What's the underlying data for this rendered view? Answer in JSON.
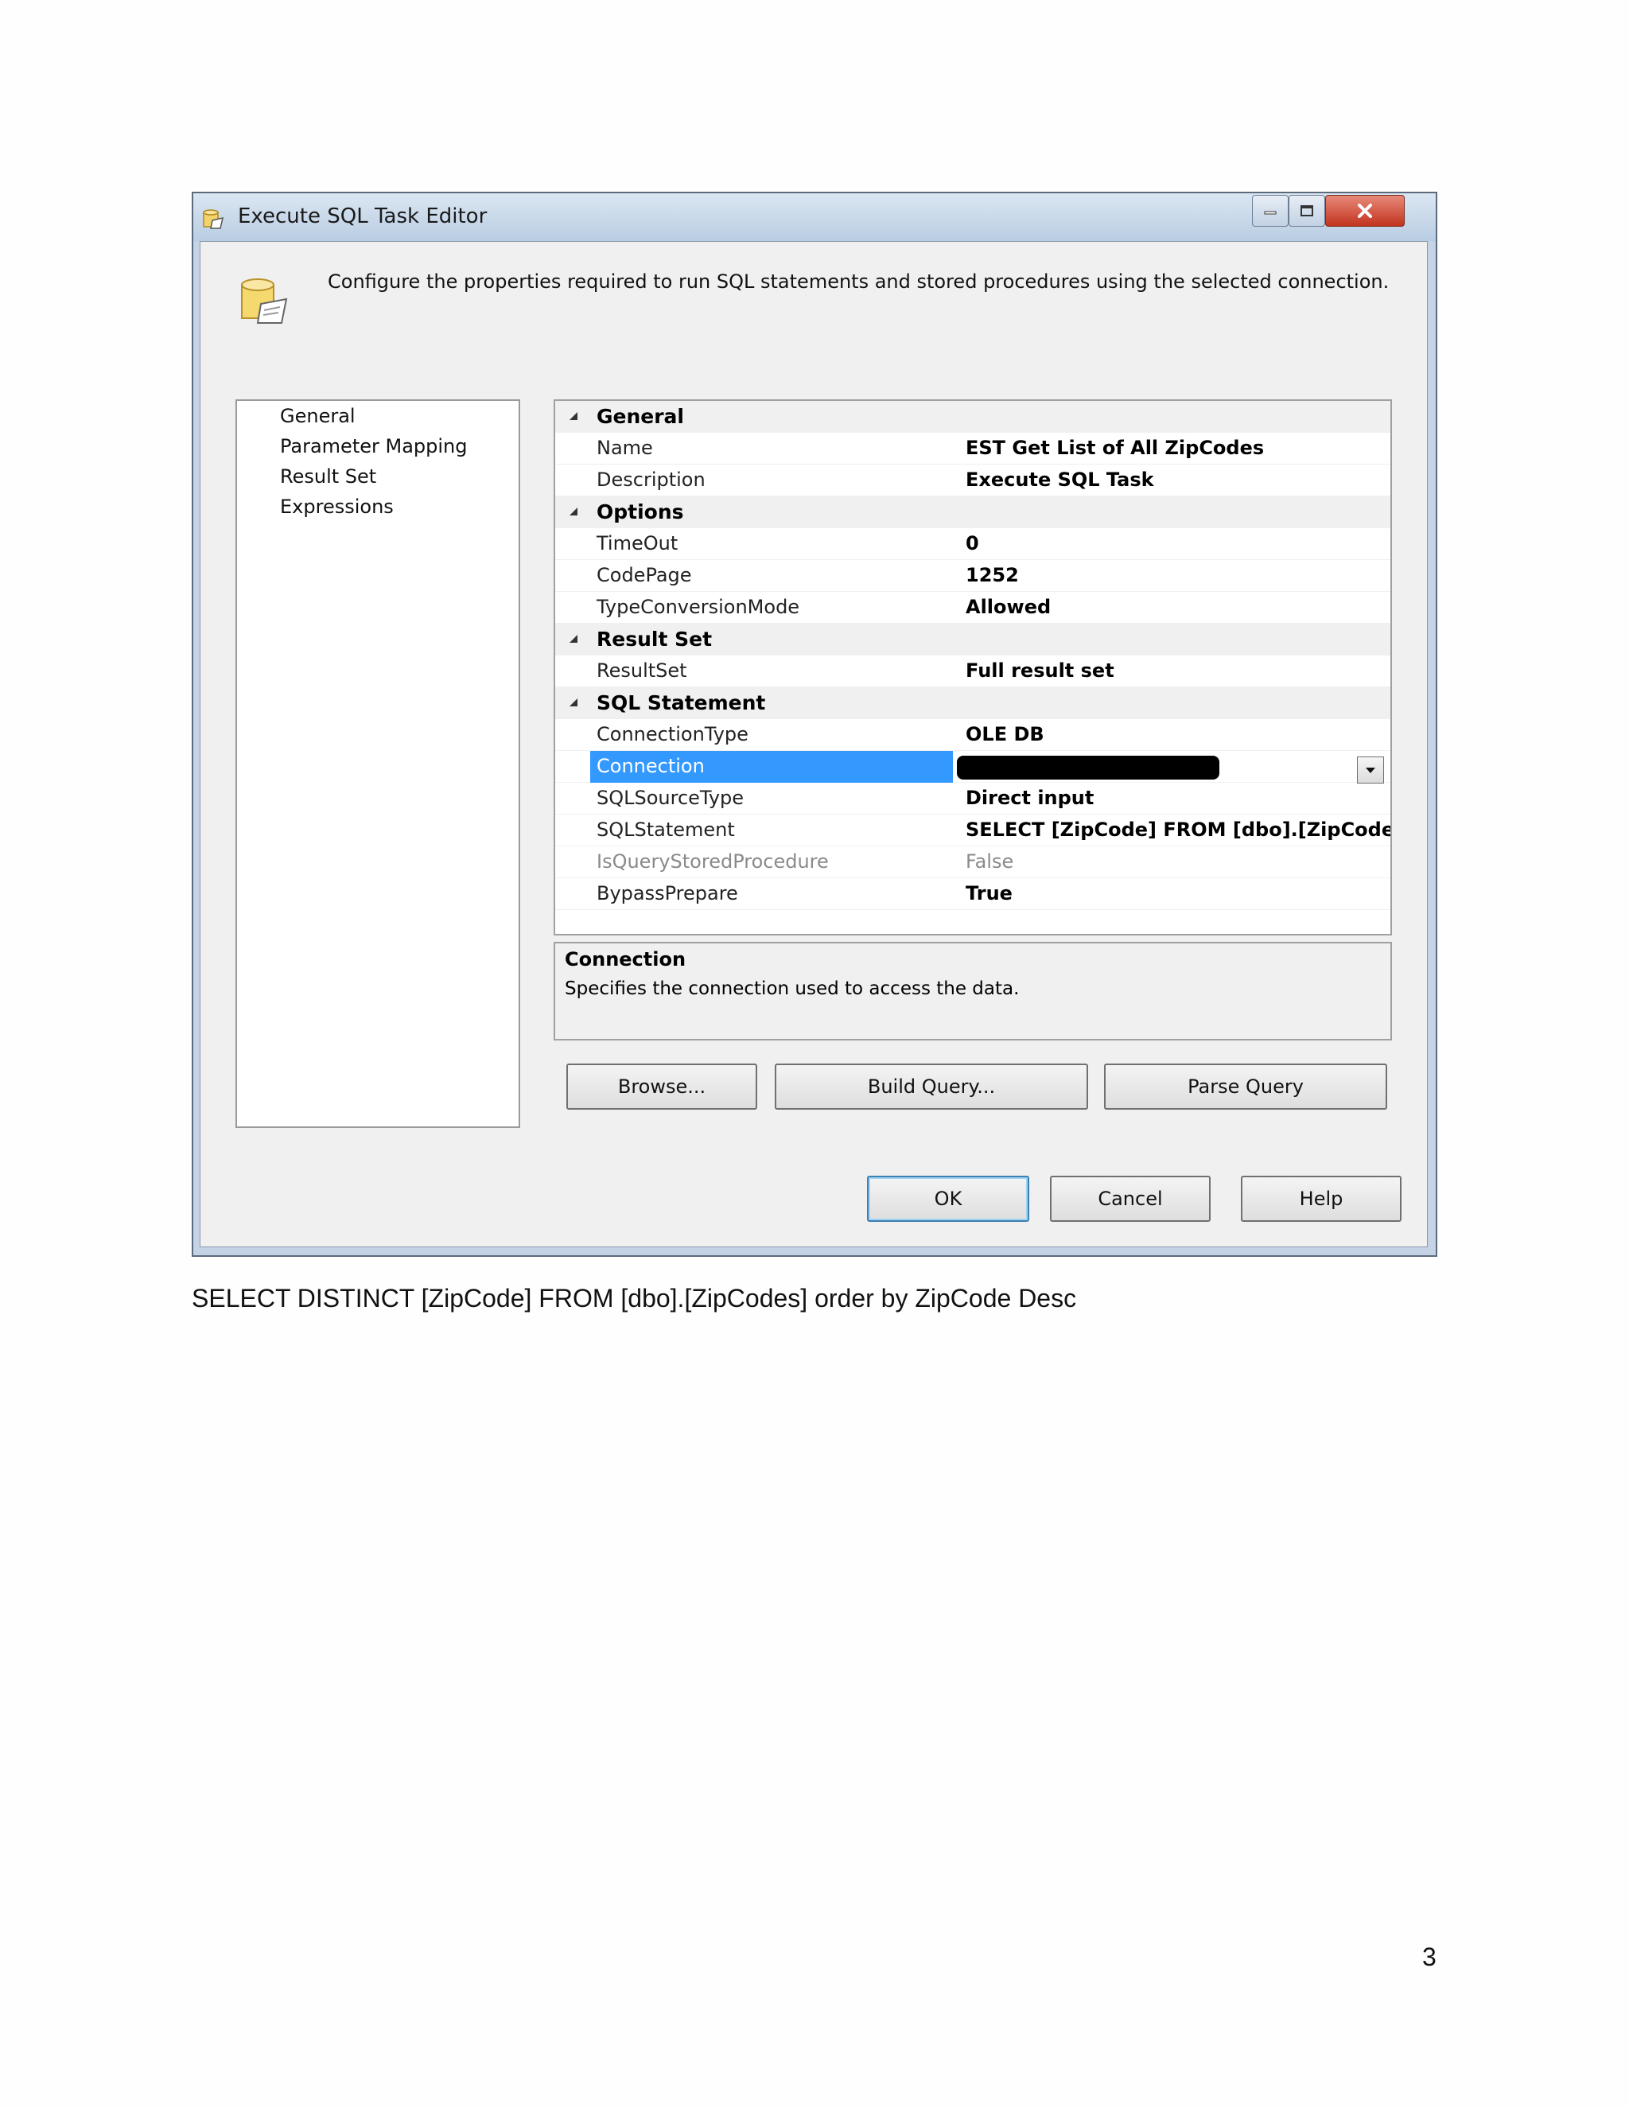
{
  "window": {
    "title": "Execute SQL Task Editor",
    "icon": "execute-sql-task-icon",
    "controls": {
      "minimize_icon": "minimize-icon",
      "maximize_icon": "maximize-icon",
      "close_icon": "close-icon"
    }
  },
  "header": {
    "description": "Configure the properties required to run SQL statements and stored procedures using the selected connection."
  },
  "sidebar": {
    "items": [
      {
        "label": "General"
      },
      {
        "label": "Parameter Mapping"
      },
      {
        "label": "Result Set"
      },
      {
        "label": "Expressions"
      }
    ]
  },
  "properties": {
    "categories": [
      {
        "label": "General",
        "rows": [
          {
            "name": "Name",
            "value": "EST Get List of All ZipCodes"
          },
          {
            "name": "Description",
            "value": "Execute SQL Task"
          }
        ]
      },
      {
        "label": "Options",
        "rows": [
          {
            "name": "TimeOut",
            "value": "0"
          },
          {
            "name": "CodePage",
            "value": "1252"
          },
          {
            "name": "TypeConversionMode",
            "value": "Allowed"
          }
        ]
      },
      {
        "label": "Result Set",
        "rows": [
          {
            "name": "ResultSet",
            "value": "Full result set"
          }
        ]
      },
      {
        "label": "SQL Statement",
        "rows": [
          {
            "name": "ConnectionType",
            "value": "OLE DB"
          },
          {
            "name": "Connection",
            "value": ""
          },
          {
            "name": "SQLSourceType",
            "value": "Direct input"
          },
          {
            "name": "SQLStatement",
            "value": "SELECT  [ZipCode]  FROM [dbo].[ZipCodes]  ord"
          },
          {
            "name": "IsQueryStoredProcedure",
            "value": "False"
          },
          {
            "name": "BypassPrepare",
            "value": "True"
          }
        ]
      }
    ],
    "selected_row": "Connection"
  },
  "help": {
    "title": "Connection",
    "text": "Specifies the connection used to access the data."
  },
  "buttons": {
    "browse": "Browse...",
    "build_query": "Build Query...",
    "parse_query": "Parse Query",
    "ok": "OK",
    "cancel": "Cancel",
    "help": "Help"
  },
  "document": {
    "caption": "SELECT DISTINCT [ZipCode] FROM [dbo].[ZipCodes]  order by ZipCode Desc",
    "page_number": "3"
  }
}
